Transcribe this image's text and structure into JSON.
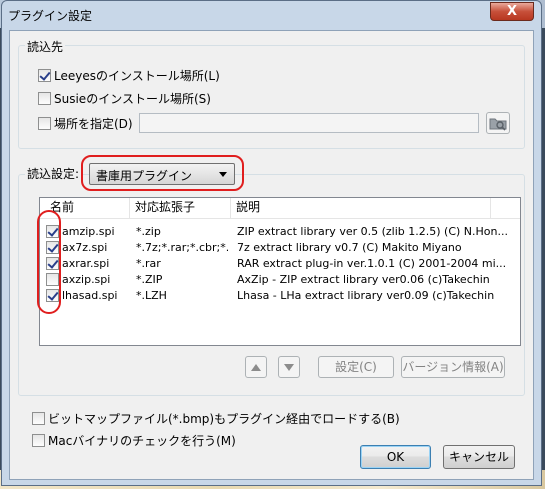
{
  "window": {
    "title": "プラグイン設定",
    "close_label": "X"
  },
  "source_group": {
    "title": "読込先",
    "options": [
      {
        "label": "Leeyesのインストール場所(L)",
        "checked": true
      },
      {
        "label": "Susieのインストール場所(S)",
        "checked": false
      },
      {
        "label": "場所を指定(D)",
        "checked": false
      }
    ],
    "path_value": ""
  },
  "settings_group": {
    "label": "読込設定:",
    "select_value": "書庫用プラグイン",
    "columns": [
      "名前",
      "対応拡張子",
      "説明"
    ],
    "rows": [
      {
        "checked": true,
        "name": "amzip.spi",
        "ext": "*.zip",
        "desc": "ZIP extract library ver 0.5 (zlib 1.2.5) (C) N.Hon..."
      },
      {
        "checked": true,
        "name": "ax7z.spi",
        "ext": "*.7z;*.rar;*.cbr;*....",
        "desc": "7z extract library v0.7 (C) Makito Miyano"
      },
      {
        "checked": true,
        "name": "axrar.spi",
        "ext": "*.rar",
        "desc": "RAR extract plug-in ver.1.0.1 (C) 2001-2004 mi..."
      },
      {
        "checked": false,
        "name": "axzip.spi",
        "ext": "*.ZIP",
        "desc": "AxZip - ZIP extract library ver0.06 (c)Takechin"
      },
      {
        "checked": true,
        "name": "lhasad.spi",
        "ext": "*.LZH",
        "desc": "Lhasa - LHa extract library ver0.09 (c)Takechin"
      }
    ],
    "settings_button": "設定(C)",
    "version_button": "バージョン情報(A)"
  },
  "bottom_options": [
    {
      "label": "ビットマップファイル(*.bmp)もプラグイン経由でロードする(B)",
      "checked": false
    },
    {
      "label": "Macバイナリのチェックを行う(M)",
      "checked": false
    }
  ],
  "buttons": {
    "ok": "OK",
    "cancel": "キャンセル"
  },
  "colors": {
    "highlight_ring": "#e01e1e",
    "frame": "#c8d7e8"
  }
}
